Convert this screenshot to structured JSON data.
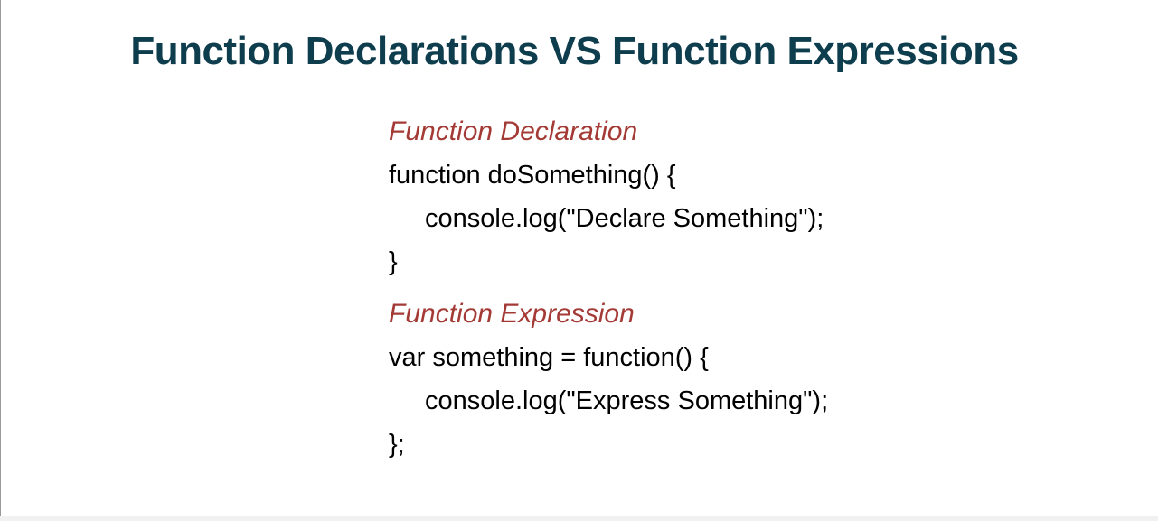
{
  "slide": {
    "title": "Function Declarations VS Function Expressions",
    "declaration": {
      "label": "Function Declaration",
      "lines": [
        "function doSomething() {",
        "console.log(\"Declare Something\");",
        "}"
      ]
    },
    "expression": {
      "label": "Function Expression",
      "lines": [
        "var something = function() {",
        "console.log(\"Express Something\");",
        "};"
      ]
    }
  },
  "colors": {
    "title": "#0e3d4d",
    "label": "#a43a35",
    "code": "#000000",
    "background": "#ffffff"
  }
}
